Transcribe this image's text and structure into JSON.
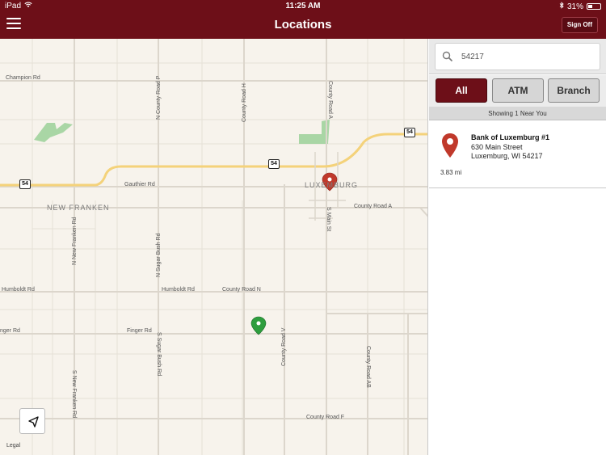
{
  "status_bar": {
    "device": "iPad",
    "time": "11:25 AM",
    "battery": "31%",
    "battery_level": 0.31
  },
  "nav": {
    "title": "Locations",
    "sign_off_label": "Sign Off"
  },
  "search": {
    "value": "54217"
  },
  "filters": [
    {
      "label": "All",
      "active": true
    },
    {
      "label": "ATM",
      "active": false
    },
    {
      "label": "Branch",
      "active": false
    }
  ],
  "results_summary": "Showing 1 Near You",
  "results": [
    {
      "name": "Bank of Luxemburg #1",
      "address_line1": "630 Main Street",
      "address_line2": "Luxemburg, WI 54217",
      "distance": "3.83 mi"
    }
  ],
  "map": {
    "legal_label": "Legal",
    "town_labels": {
      "new_franken": "NEW FRANKEN",
      "luxemburg": "LUXEMBURG"
    },
    "road_labels": {
      "champion_rd": "Champion Rd",
      "gauthier_rd": "Gauthier Rd",
      "county_road_a": "County Road A",
      "humboldt_rd_left": "Humboldt Rd",
      "humboldt_rd": "Humboldt Rd",
      "county_road_n": "County Road N",
      "finger_rd_left": "nger Rd",
      "finger_rd": "Finger Rd",
      "county_road_f": "County Road F",
      "n_county_road_p": "N County Road P",
      "county_road_h": "County Road H",
      "county_road_a_vertical": "County Road A",
      "n_new_franken_rd": "N New Franken Rd",
      "n_sugar_bush_rd": "N Sugar Bush Rd",
      "s_main_st": "S Main St",
      "county_road_v": "County Road V",
      "county_road_ab": "County Road AB",
      "s_sugar_bush_rd": "S Sugar Bush Rd",
      "s_new_franken_rd": "S New Franken Rd"
    },
    "highway_shields": [
      "54",
      "54",
      "54"
    ],
    "pin_colors": {
      "bank": "#c0392b",
      "user": "#2e9e3e"
    }
  },
  "colors": {
    "brand": "#6d0f18",
    "road_highway": "#f4d27a",
    "park": "#a9d6a5"
  },
  "icons": {
    "menu": "hamburger-icon",
    "search": "search-icon",
    "locate": "location-arrow-icon",
    "pin": "map-pin-icon"
  }
}
